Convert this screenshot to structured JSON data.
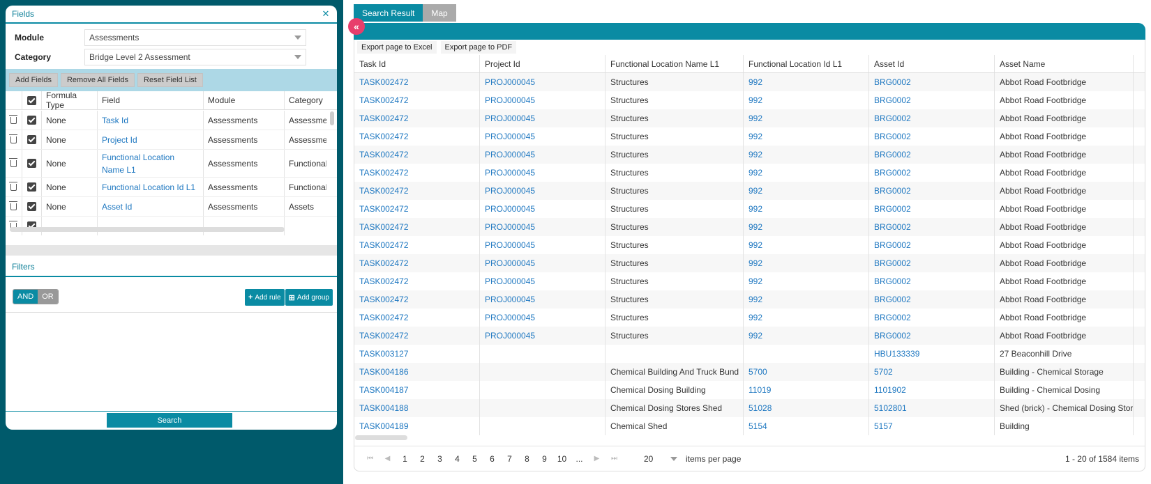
{
  "fields_panel": {
    "title": "Fields",
    "module_label": "Module",
    "module_value": "Assessments",
    "category_label": "Category",
    "category_value": "Bridge Level 2 Assessment",
    "toolbar": {
      "add_fields": "Add Fields",
      "remove_all": "Remove All Fields",
      "reset": "Reset Field List"
    },
    "columns": [
      "Formula Type",
      "Field",
      "Module",
      "Category"
    ],
    "rows": [
      {
        "formula": "None",
        "field": "Task Id",
        "module": "Assessments",
        "category": "Assessments"
      },
      {
        "formula": "None",
        "field": "Project Id",
        "module": "Assessments",
        "category": "Assessments"
      },
      {
        "formula": "None",
        "field": "Functional Location Name L1",
        "module": "Assessments",
        "category": "Functional"
      },
      {
        "formula": "None",
        "field": "Functional Location Id L1",
        "module": "Assessments",
        "category": "Functional"
      },
      {
        "formula": "None",
        "field": "Asset Id",
        "module": "Assessments",
        "category": "Assets"
      }
    ]
  },
  "filters_panel": {
    "title": "Filters",
    "and_label": "AND",
    "or_label": "OR",
    "add_rule": "Add rule",
    "add_group": "Add group",
    "search": "Search"
  },
  "tabs": {
    "search_result": "Search Result",
    "map": "Map"
  },
  "results": {
    "export_excel": "Export page to Excel",
    "export_pdf": "Export page to PDF",
    "columns": [
      "Task Id",
      "Project Id",
      "Functional Location Name L1",
      "Functional Location Id L1",
      "Asset Id",
      "Asset Name"
    ],
    "rows": [
      [
        "TASK002472",
        "PROJ000045",
        "Structures",
        "992",
        "BRG0002",
        "Abbot Road Footbridge"
      ],
      [
        "TASK002472",
        "PROJ000045",
        "Structures",
        "992",
        "BRG0002",
        "Abbot Road Footbridge"
      ],
      [
        "TASK002472",
        "PROJ000045",
        "Structures",
        "992",
        "BRG0002",
        "Abbot Road Footbridge"
      ],
      [
        "TASK002472",
        "PROJ000045",
        "Structures",
        "992",
        "BRG0002",
        "Abbot Road Footbridge"
      ],
      [
        "TASK002472",
        "PROJ000045",
        "Structures",
        "992",
        "BRG0002",
        "Abbot Road Footbridge"
      ],
      [
        "TASK002472",
        "PROJ000045",
        "Structures",
        "992",
        "BRG0002",
        "Abbot Road Footbridge"
      ],
      [
        "TASK002472",
        "PROJ000045",
        "Structures",
        "992",
        "BRG0002",
        "Abbot Road Footbridge"
      ],
      [
        "TASK002472",
        "PROJ000045",
        "Structures",
        "992",
        "BRG0002",
        "Abbot Road Footbridge"
      ],
      [
        "TASK002472",
        "PROJ000045",
        "Structures",
        "992",
        "BRG0002",
        "Abbot Road Footbridge"
      ],
      [
        "TASK002472",
        "PROJ000045",
        "Structures",
        "992",
        "BRG0002",
        "Abbot Road Footbridge"
      ],
      [
        "TASK002472",
        "PROJ000045",
        "Structures",
        "992",
        "BRG0002",
        "Abbot Road Footbridge"
      ],
      [
        "TASK002472",
        "PROJ000045",
        "Structures",
        "992",
        "BRG0002",
        "Abbot Road Footbridge"
      ],
      [
        "TASK002472",
        "PROJ000045",
        "Structures",
        "992",
        "BRG0002",
        "Abbot Road Footbridge"
      ],
      [
        "TASK002472",
        "PROJ000045",
        "Structures",
        "992",
        "BRG0002",
        "Abbot Road Footbridge"
      ],
      [
        "TASK002472",
        "PROJ000045",
        "Structures",
        "992",
        "BRG0002",
        "Abbot Road Footbridge"
      ],
      [
        "TASK003127",
        "",
        "",
        "",
        "HBU133339",
        "27 Beaconhill Drive"
      ],
      [
        "TASK004186",
        "",
        "Chemical Building And Truck Bund",
        "5700",
        "5702",
        "Building - Chemical Storage"
      ],
      [
        "TASK004187",
        "",
        "Chemical Dosing Building",
        "11019",
        "1101902",
        "Building - Chemical Dosing"
      ],
      [
        "TASK004188",
        "",
        "Chemical Dosing Stores Shed",
        "51028",
        "5102801",
        "Shed (brick) - Chemical Dosing Stores"
      ],
      [
        "TASK004189",
        "",
        "Chemical Shed",
        "5154",
        "5157",
        "Building"
      ]
    ],
    "pager": {
      "pages": [
        "1",
        "2",
        "3",
        "4",
        "5",
        "6",
        "7",
        "8",
        "9",
        "10",
        "..."
      ],
      "per_page": "20",
      "per_page_label": "items per page",
      "info": "1 - 20 of 1584 items"
    }
  }
}
